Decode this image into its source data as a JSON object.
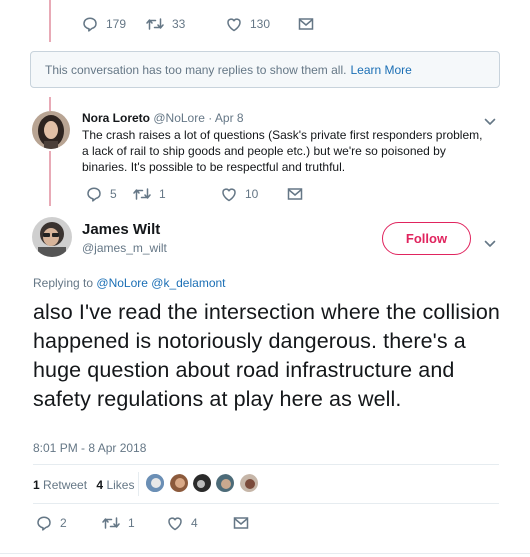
{
  "top_tweet": {
    "reply_count": "179",
    "retweet_count": "33",
    "like_count": "130"
  },
  "notice": {
    "text": "This conversation has too many replies to show them all.",
    "link": "Learn More"
  },
  "reply": {
    "author_name": "Nora Loreto",
    "author_handle": "@NoLore",
    "separator": "·",
    "date": "Apr 8",
    "text": "The crash raises a lot of questions (Sask's private first responders problem, a lack of rail to ship goods and people etc.) but we're so poisoned by binaries. It's possible to be respectful and truthful.",
    "reply_count": "5",
    "retweet_count": "1",
    "like_count": "10"
  },
  "main_tweet": {
    "author_name": "James Wilt",
    "author_handle": "@james_m_wilt",
    "follow_label": "Follow",
    "replying_to_label": "Replying to",
    "replying_to_1": "@NoLore",
    "replying_to_2": "@k_delamont",
    "text": "also I've read the intersection where the collision happened is notoriously dangerous. there's a huge question about road infrastructure and safety regulations at play here as well.",
    "timestamp": "8:01 PM - 8 Apr 2018",
    "retweets_count": "1",
    "retweets_label": "Retweet",
    "likes_count": "4",
    "likes_label": "Likes",
    "reply_count": "2",
    "retweet_count": "1",
    "like_count": "4"
  },
  "colors": {
    "follow": "#e0245e",
    "link": "#1b6fb5",
    "muted": "#657786",
    "thread_line": "#e8aab6"
  },
  "icons": [
    "reply-icon",
    "retweet-icon",
    "like-icon",
    "message-icon",
    "chevron-down-icon"
  ]
}
